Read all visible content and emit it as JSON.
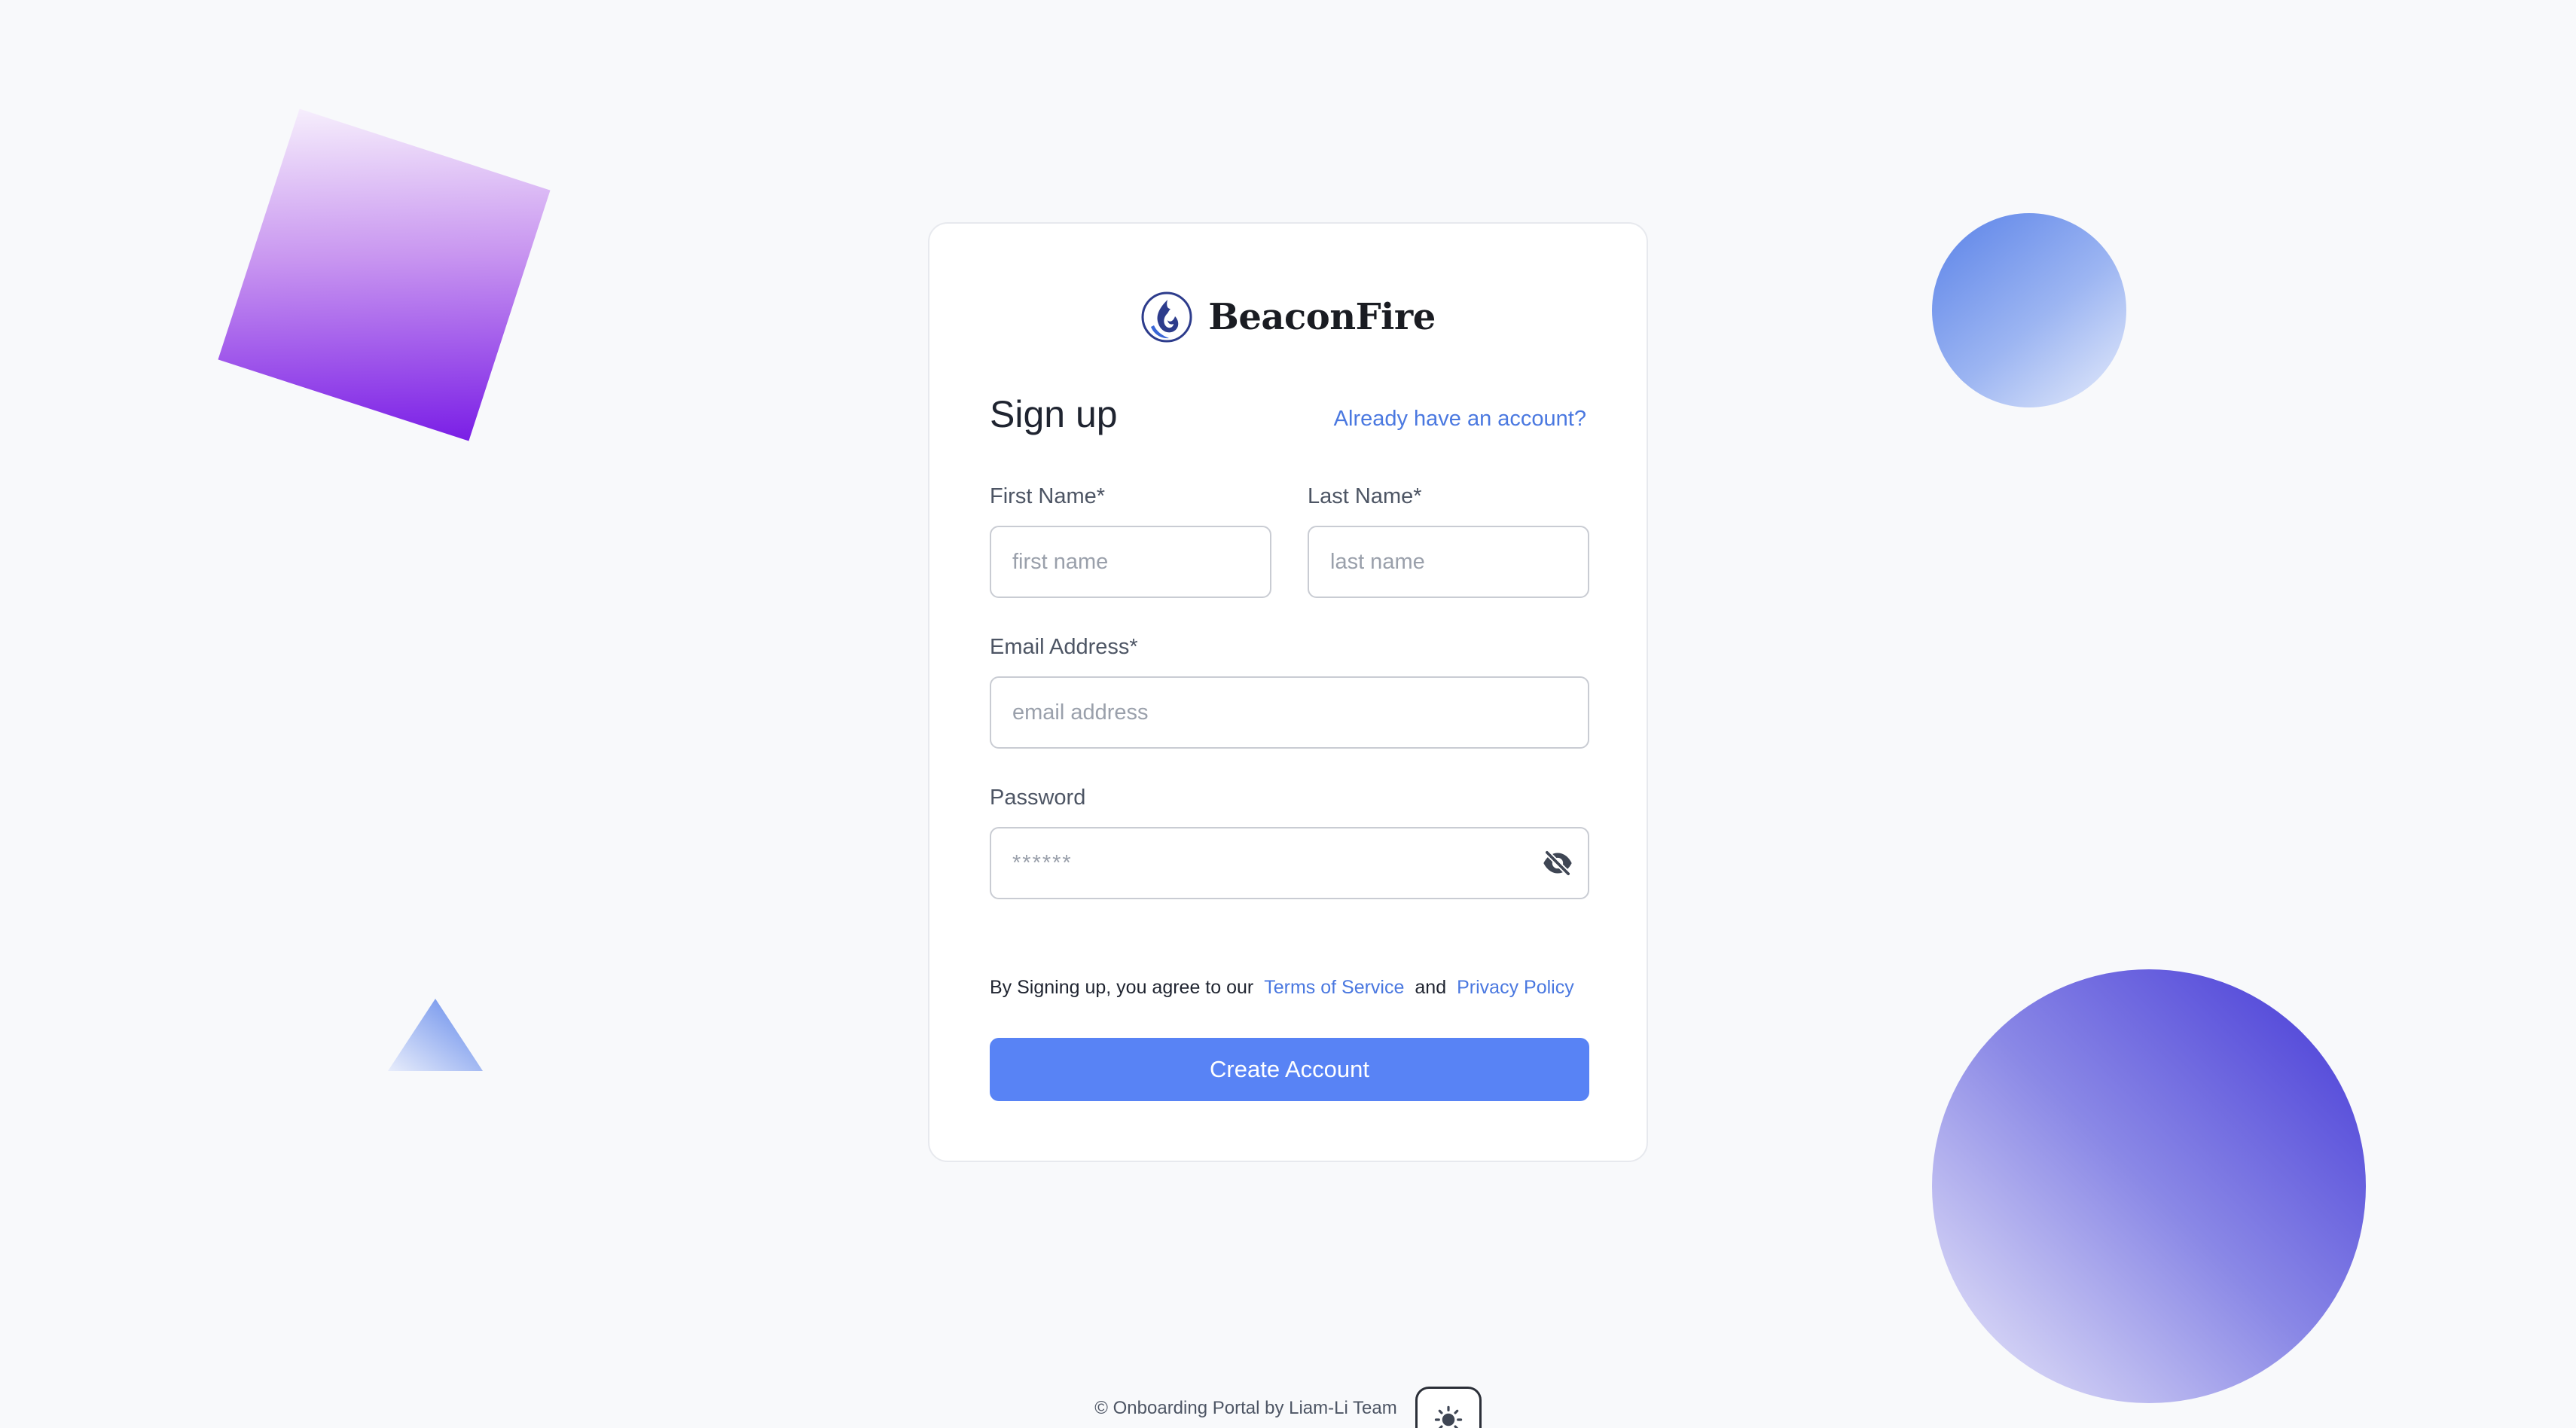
{
  "brand": {
    "name": "BeaconFire",
    "logo_icon": "flame-logo-icon"
  },
  "form": {
    "title": "Sign up",
    "signin_link": "Already have an account?",
    "first_name": {
      "label": "First Name*",
      "placeholder": "first name"
    },
    "last_name": {
      "label": "Last Name*",
      "placeholder": "last name"
    },
    "email": {
      "label": "Email Address*",
      "placeholder": "email address"
    },
    "password": {
      "label": "Password",
      "placeholder": "******",
      "toggle_icon": "eye-slash-icon"
    },
    "terms": {
      "prefix": "By Signing up, you agree to our",
      "tos": "Terms of Service",
      "and": "and",
      "privacy": "Privacy Policy"
    },
    "submit_label": "Create Account"
  },
  "footer": {
    "text": "© Onboarding Portal by Liam-Li Team",
    "theme_icon": "sun-icon"
  },
  "colors": {
    "accent": "#5883f5",
    "link": "#4a78e0",
    "background": "#f8f9fb",
    "card": "#ffffff"
  }
}
